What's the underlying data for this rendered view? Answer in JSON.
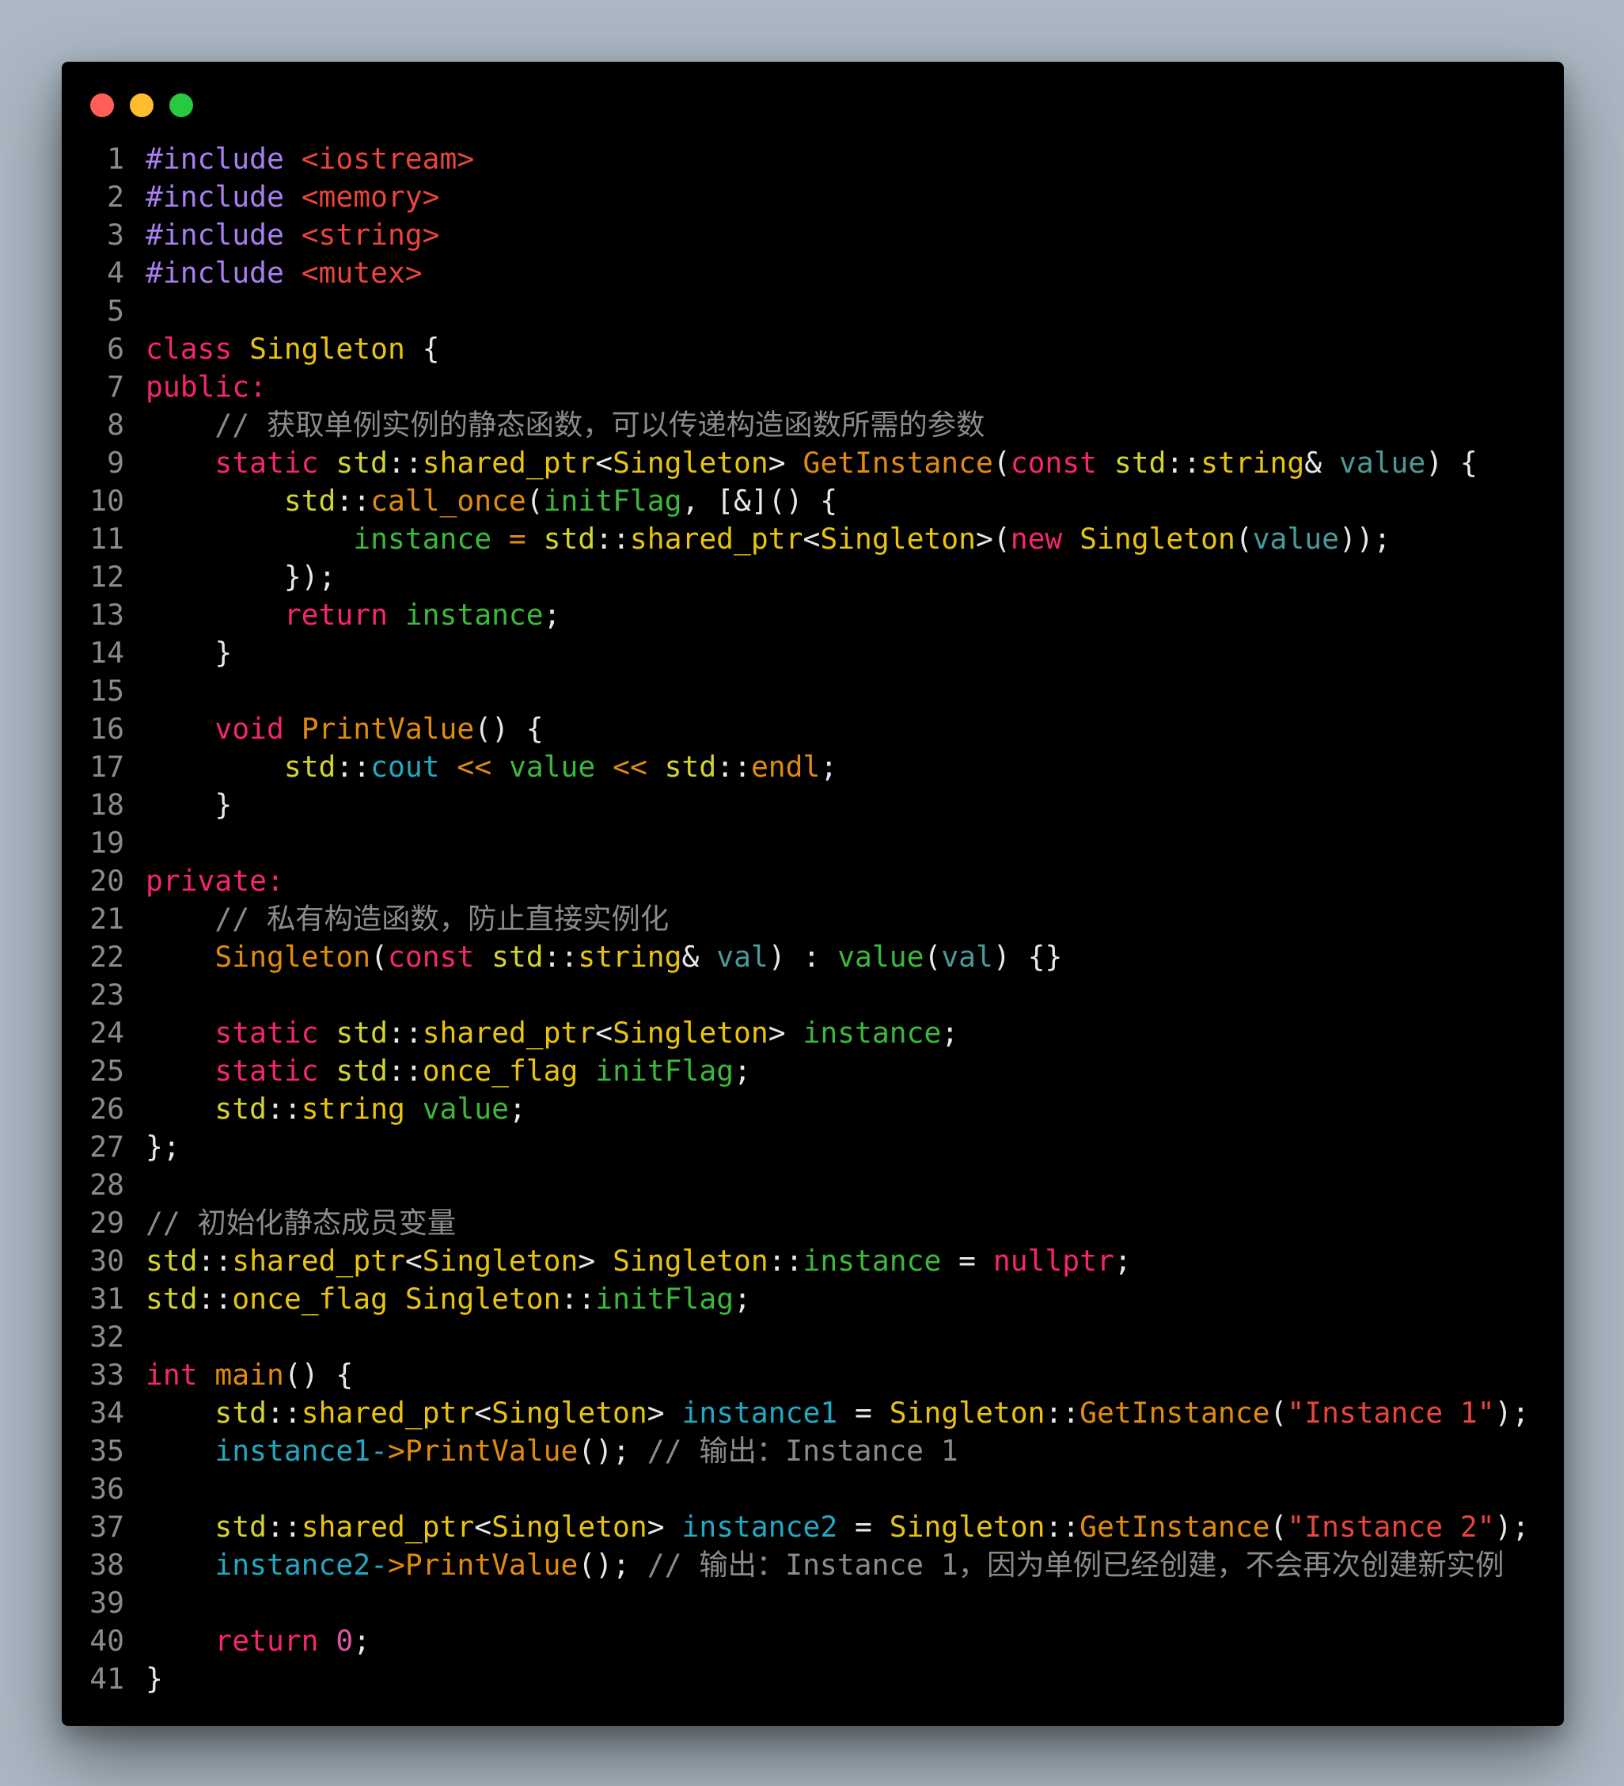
{
  "window": {
    "traffic_lights": [
      {
        "name": "close",
        "color": "#ff5f57"
      },
      {
        "name": "minimize",
        "color": "#febc2e"
      },
      {
        "name": "maximize",
        "color": "#28c840"
      }
    ]
  },
  "code": {
    "language": "cpp",
    "lines": [
      [
        [
          "pre",
          "#include"
        ],
        [
          "punc",
          " "
        ],
        [
          "inc",
          "<iostream>"
        ]
      ],
      [
        [
          "pre",
          "#include"
        ],
        [
          "punc",
          " "
        ],
        [
          "inc",
          "<memory>"
        ]
      ],
      [
        [
          "pre",
          "#include"
        ],
        [
          "punc",
          " "
        ],
        [
          "inc",
          "<string>"
        ]
      ],
      [
        [
          "pre",
          "#include"
        ],
        [
          "punc",
          " "
        ],
        [
          "inc",
          "<mutex>"
        ]
      ],
      [],
      [
        [
          "kw",
          "class"
        ],
        [
          "punc",
          " "
        ],
        [
          "type",
          "Singleton"
        ],
        [
          "punc",
          " {"
        ]
      ],
      [
        [
          "kw",
          "public:"
        ]
      ],
      [
        [
          "punc",
          "    "
        ],
        [
          "cmt",
          "// 获取单例实例的静态函数，可以传递构造函数所需的参数"
        ]
      ],
      [
        [
          "punc",
          "    "
        ],
        [
          "kw",
          "static"
        ],
        [
          "punc",
          " "
        ],
        [
          "ns",
          "std"
        ],
        [
          "punc",
          "::"
        ],
        [
          "type",
          "shared_ptr"
        ],
        [
          "punc",
          "<"
        ],
        [
          "type",
          "Singleton"
        ],
        [
          "punc",
          "> "
        ],
        [
          "fn",
          "GetInstance"
        ],
        [
          "punc",
          "("
        ],
        [
          "kw",
          "const"
        ],
        [
          "punc",
          " "
        ],
        [
          "ns",
          "std"
        ],
        [
          "punc",
          "::"
        ],
        [
          "type",
          "string"
        ],
        [
          "punc",
          "& "
        ],
        [
          "param",
          "value"
        ],
        [
          "punc",
          ") {"
        ]
      ],
      [
        [
          "punc",
          "        "
        ],
        [
          "ns",
          "std"
        ],
        [
          "punc",
          "::"
        ],
        [
          "fn",
          "call_once"
        ],
        [
          "punc",
          "("
        ],
        [
          "var",
          "initFlag"
        ],
        [
          "punc",
          ", [&]() {"
        ]
      ],
      [
        [
          "punc",
          "            "
        ],
        [
          "var",
          "instance"
        ],
        [
          "punc",
          " "
        ],
        [
          "op",
          "="
        ],
        [
          "punc",
          " "
        ],
        [
          "ns",
          "std"
        ],
        [
          "punc",
          "::"
        ],
        [
          "type",
          "shared_ptr"
        ],
        [
          "punc",
          "<"
        ],
        [
          "type",
          "Singleton"
        ],
        [
          "punc",
          ">("
        ],
        [
          "kw",
          "new"
        ],
        [
          "punc",
          " "
        ],
        [
          "type",
          "Singleton"
        ],
        [
          "punc",
          "("
        ],
        [
          "param",
          "value"
        ],
        [
          "punc",
          "));"
        ]
      ],
      [
        [
          "punc",
          "        });"
        ]
      ],
      [
        [
          "punc",
          "        "
        ],
        [
          "kw",
          "return"
        ],
        [
          "punc",
          " "
        ],
        [
          "var",
          "instance"
        ],
        [
          "punc",
          ";"
        ]
      ],
      [
        [
          "punc",
          "    }"
        ]
      ],
      [],
      [
        [
          "punc",
          "    "
        ],
        [
          "kw",
          "void"
        ],
        [
          "punc",
          " "
        ],
        [
          "fn",
          "PrintValue"
        ],
        [
          "punc",
          "() {"
        ]
      ],
      [
        [
          "punc",
          "        "
        ],
        [
          "ns",
          "std"
        ],
        [
          "punc",
          "::"
        ],
        [
          "cyan",
          "cout"
        ],
        [
          "punc",
          " "
        ],
        [
          "op",
          "<<"
        ],
        [
          "punc",
          " "
        ],
        [
          "var",
          "value"
        ],
        [
          "punc",
          " "
        ],
        [
          "op",
          "<<"
        ],
        [
          "punc",
          " "
        ],
        [
          "ns",
          "std"
        ],
        [
          "punc",
          "::"
        ],
        [
          "fn",
          "endl"
        ],
        [
          "punc",
          ";"
        ]
      ],
      [
        [
          "punc",
          "    }"
        ]
      ],
      [],
      [
        [
          "kw",
          "private:"
        ]
      ],
      [
        [
          "punc",
          "    "
        ],
        [
          "cmt",
          "// 私有构造函数，防止直接实例化"
        ]
      ],
      [
        [
          "punc",
          "    "
        ],
        [
          "fn",
          "Singleton"
        ],
        [
          "punc",
          "("
        ],
        [
          "kw",
          "const"
        ],
        [
          "punc",
          " "
        ],
        [
          "ns",
          "std"
        ],
        [
          "punc",
          "::"
        ],
        [
          "type",
          "string"
        ],
        [
          "punc",
          "& "
        ],
        [
          "param",
          "val"
        ],
        [
          "punc",
          ") : "
        ],
        [
          "var",
          "value"
        ],
        [
          "punc",
          "("
        ],
        [
          "param",
          "val"
        ],
        [
          "punc",
          ") {}"
        ]
      ],
      [],
      [
        [
          "punc",
          "    "
        ],
        [
          "kw",
          "static"
        ],
        [
          "punc",
          " "
        ],
        [
          "ns",
          "std"
        ],
        [
          "punc",
          "::"
        ],
        [
          "type",
          "shared_ptr"
        ],
        [
          "punc",
          "<"
        ],
        [
          "type",
          "Singleton"
        ],
        [
          "punc",
          "> "
        ],
        [
          "var",
          "instance"
        ],
        [
          "punc",
          ";"
        ]
      ],
      [
        [
          "punc",
          "    "
        ],
        [
          "kw",
          "static"
        ],
        [
          "punc",
          " "
        ],
        [
          "ns",
          "std"
        ],
        [
          "punc",
          "::"
        ],
        [
          "type",
          "once_flag"
        ],
        [
          "punc",
          " "
        ],
        [
          "var",
          "initFlag"
        ],
        [
          "punc",
          ";"
        ]
      ],
      [
        [
          "punc",
          "    "
        ],
        [
          "ns",
          "std"
        ],
        [
          "punc",
          "::"
        ],
        [
          "type",
          "string"
        ],
        [
          "punc",
          " "
        ],
        [
          "var",
          "value"
        ],
        [
          "punc",
          ";"
        ]
      ],
      [
        [
          "punc",
          "};"
        ]
      ],
      [],
      [
        [
          "cmt",
          "// 初始化静态成员变量"
        ]
      ],
      [
        [
          "ns",
          "std"
        ],
        [
          "punc",
          "::"
        ],
        [
          "type",
          "shared_ptr"
        ],
        [
          "punc",
          "<"
        ],
        [
          "type",
          "Singleton"
        ],
        [
          "punc",
          "> "
        ],
        [
          "type",
          "Singleton"
        ],
        [
          "punc",
          "::"
        ],
        [
          "var",
          "instance"
        ],
        [
          "punc",
          " = "
        ],
        [
          "kw",
          "nullptr"
        ],
        [
          "punc",
          ";"
        ]
      ],
      [
        [
          "ns",
          "std"
        ],
        [
          "punc",
          "::"
        ],
        [
          "type",
          "once_flag"
        ],
        [
          "punc",
          " "
        ],
        [
          "type",
          "Singleton"
        ],
        [
          "punc",
          "::"
        ],
        [
          "var",
          "initFlag"
        ],
        [
          "punc",
          ";"
        ]
      ],
      [],
      [
        [
          "kw",
          "int"
        ],
        [
          "punc",
          " "
        ],
        [
          "fn",
          "main"
        ],
        [
          "punc",
          "() {"
        ]
      ],
      [
        [
          "punc",
          "    "
        ],
        [
          "ns",
          "std"
        ],
        [
          "punc",
          "::"
        ],
        [
          "type",
          "shared_ptr"
        ],
        [
          "punc",
          "<"
        ],
        [
          "type",
          "Singleton"
        ],
        [
          "punc",
          "> "
        ],
        [
          "cyan",
          "instance1"
        ],
        [
          "punc",
          " = "
        ],
        [
          "type",
          "Singleton"
        ],
        [
          "punc",
          "::"
        ],
        [
          "fn",
          "GetInstance"
        ],
        [
          "punc",
          "("
        ],
        [
          "str",
          "\"Instance 1\""
        ],
        [
          "punc",
          ");"
        ]
      ],
      [
        [
          "punc",
          "    "
        ],
        [
          "cyan",
          "instance1-"
        ],
        [
          "op",
          ">"
        ],
        [
          "fn",
          "PrintValue"
        ],
        [
          "punc",
          "(); "
        ],
        [
          "cmt",
          "// 输出：Instance 1"
        ]
      ],
      [],
      [
        [
          "punc",
          "    "
        ],
        [
          "ns",
          "std"
        ],
        [
          "punc",
          "::"
        ],
        [
          "type",
          "shared_ptr"
        ],
        [
          "punc",
          "<"
        ],
        [
          "type",
          "Singleton"
        ],
        [
          "punc",
          "> "
        ],
        [
          "cyan",
          "instance2"
        ],
        [
          "punc",
          " = "
        ],
        [
          "type",
          "Singleton"
        ],
        [
          "punc",
          "::"
        ],
        [
          "fn",
          "GetInstance"
        ],
        [
          "punc",
          "("
        ],
        [
          "str",
          "\"Instance 2\""
        ],
        [
          "punc",
          ");"
        ]
      ],
      [
        [
          "punc",
          "    "
        ],
        [
          "cyan",
          "instance2-"
        ],
        [
          "op",
          ">"
        ],
        [
          "fn",
          "PrintValue"
        ],
        [
          "punc",
          "(); "
        ],
        [
          "cmt",
          "// 输出：Instance 1，因为单例已经创建，不会再次创建新实例"
        ]
      ],
      [],
      [
        [
          "punc",
          "    "
        ],
        [
          "kw",
          "return"
        ],
        [
          "punc",
          " "
        ],
        [
          "num",
          "0"
        ],
        [
          "punc",
          ";"
        ]
      ],
      [
        [
          "punc",
          "}"
        ]
      ]
    ]
  }
}
